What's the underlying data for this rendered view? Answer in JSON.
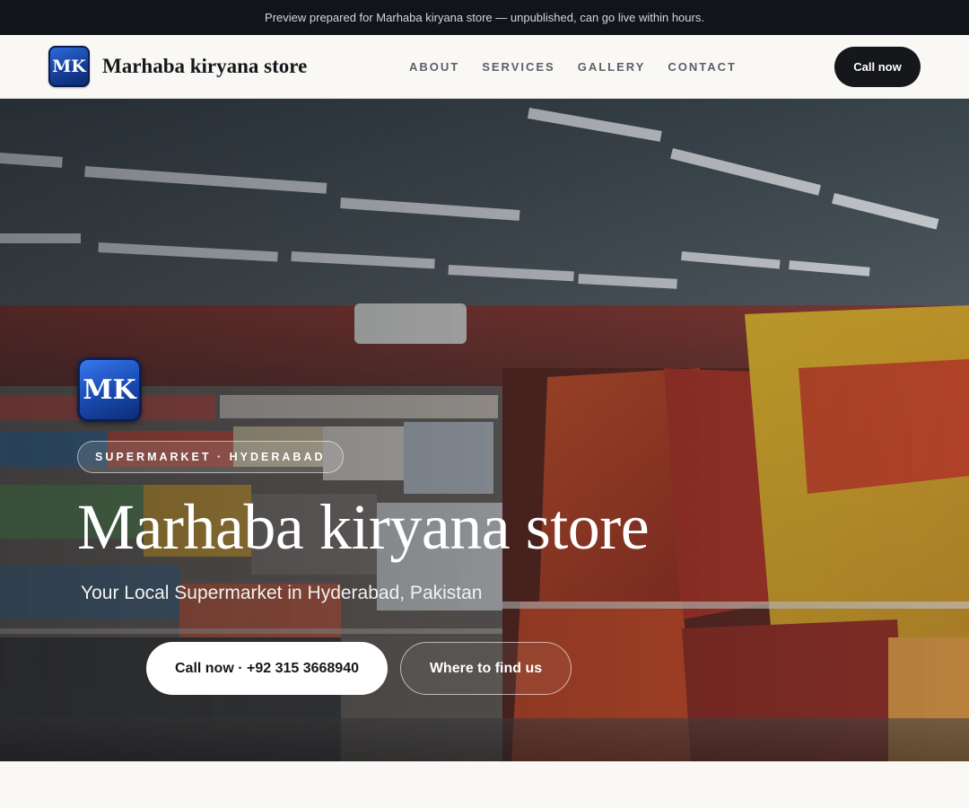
{
  "preview_bar": {
    "text": "Preview prepared for Marhaba kiryana store — unpublished, can go live within hours."
  },
  "header": {
    "logo_initials": "MK",
    "brand_name": "Marhaba kiryana store",
    "nav": [
      "ABOUT",
      "SERVICES",
      "GALLERY",
      "CONTACT"
    ],
    "cta_label": "Call now"
  },
  "hero": {
    "logo_initials": "MK",
    "badge": "SUPERMARKET · HYDERABAD",
    "title": "Marhaba kiryana store",
    "subtitle": "Your Local Supermarket in Hyderabad, Pakistan",
    "primary_button": "Call now · +92 315 3668940",
    "secondary_button": "Where to find us"
  },
  "colors": {
    "dark": "#15171b",
    "page_background": "#f9f8f5",
    "logo_blue": "#1a4cb4"
  }
}
